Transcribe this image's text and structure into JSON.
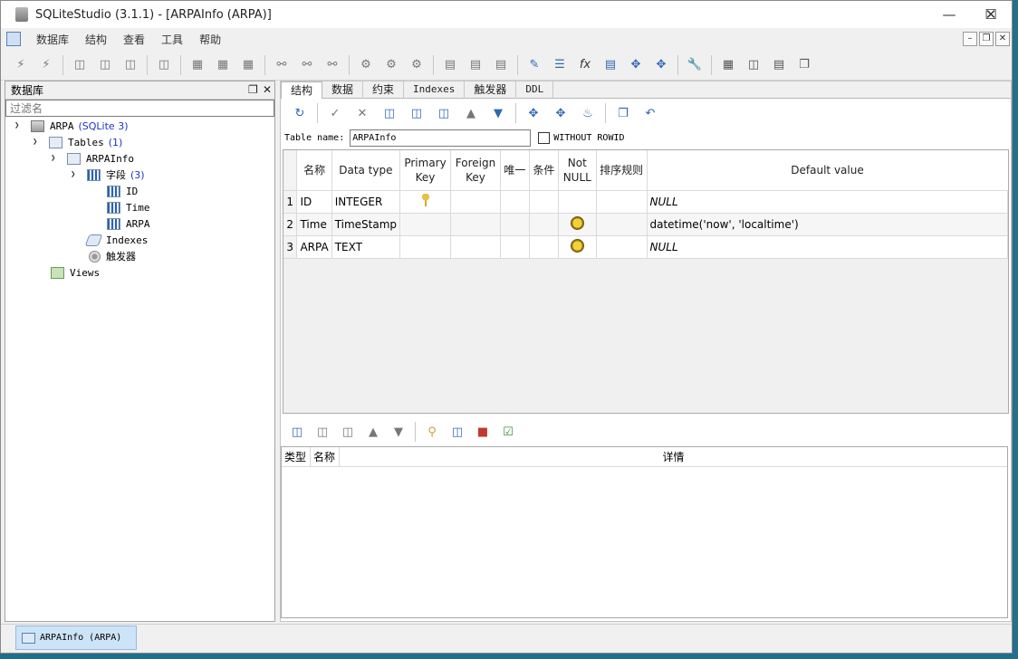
{
  "window": {
    "title": "SQLiteStudio (3.1.1) - [ARPAInfo (ARPA)]"
  },
  "menu": [
    "数据库",
    "结构",
    "查看",
    "工具",
    "帮助"
  ],
  "db_panel": {
    "title": "数据库",
    "filter_placeholder": "过滤名",
    "tree": {
      "db_name": "ARPA",
      "db_type": "(SQLite 3)",
      "tables_label": "Tables",
      "tables_count": "(1)",
      "table_name": "ARPAInfo",
      "columns_label": "字段",
      "columns_count": "(3)",
      "columns": [
        "ID",
        "Time",
        "ARPA"
      ],
      "indexes_label": "Indexes",
      "triggers_label": "触发器",
      "views_label": "Views"
    }
  },
  "editor": {
    "tabs": [
      "结构",
      "数据",
      "约束",
      "Indexes",
      "触发器",
      "DDL"
    ],
    "table_name_label": "Table name:",
    "table_name_value": "ARPAInfo",
    "without_rowid_label": "WITHOUT ROWID",
    "headers": {
      "name": "名称",
      "type": "Data type",
      "pk": "Primary Key",
      "fk": "Foreign Key",
      "unique": "唯一",
      "check": "条件",
      "notnull": "Not NULL",
      "collate": "排序规则",
      "default": "Default value"
    },
    "rows": [
      {
        "num": "1",
        "name": "ID",
        "type": "INTEGER",
        "pk": true,
        "notnull": false,
        "default": "NULL",
        "default_null": true
      },
      {
        "num": "2",
        "name": "Time",
        "type": "TimeStamp",
        "pk": false,
        "notnull": true,
        "default": "datetime('now', 'localtime')",
        "default_null": false
      },
      {
        "num": "3",
        "name": "ARPA",
        "type": "TEXT",
        "pk": false,
        "notnull": true,
        "default": "NULL",
        "default_null": true
      }
    ],
    "constraints_headers": {
      "type": "类型",
      "name": "名称",
      "details": "详情"
    }
  },
  "statusbar": {
    "window_tab": "ARPAInfo (ARPA)"
  }
}
